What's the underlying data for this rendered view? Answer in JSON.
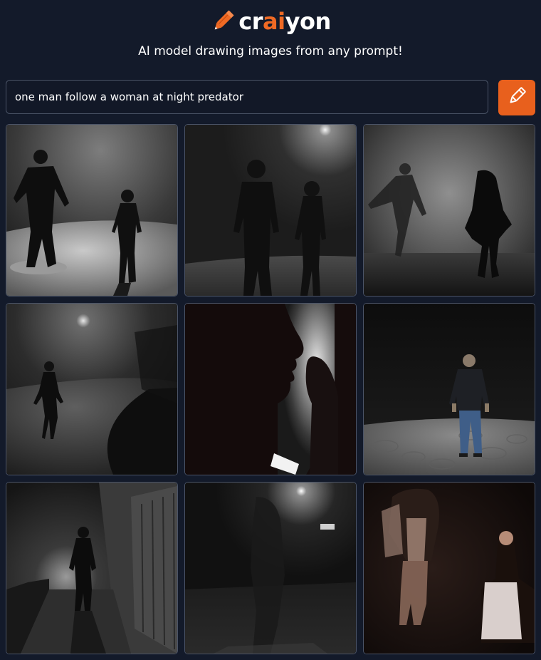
{
  "header": {
    "logo": {
      "prefix": "cr",
      "accent": "ai",
      "suffix": "yon",
      "icon": "pencil-icon"
    },
    "tagline": "AI model drawing images from any prompt!"
  },
  "prompt": {
    "value": "one man follow a woman at night predator",
    "button_icon": "pencil-icon"
  },
  "colors": {
    "background": "#131a2a",
    "accent": "#e8601d",
    "logo_accent": "#f06a24",
    "border": "#4a5366"
  },
  "gallery": {
    "count": 9
  }
}
